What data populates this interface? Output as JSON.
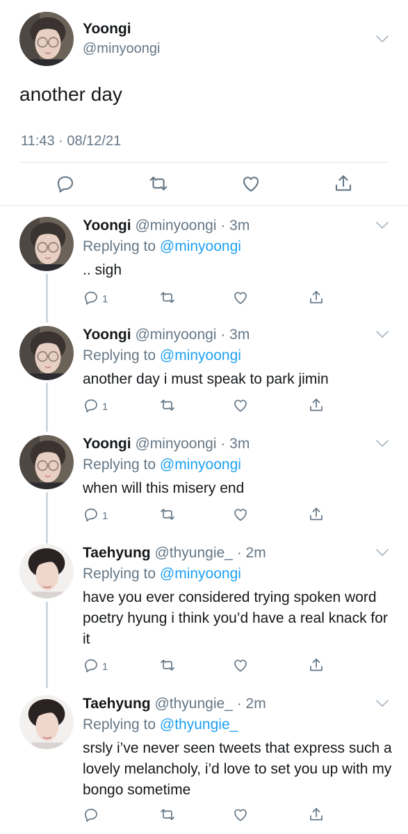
{
  "main": {
    "name": "Yoongi",
    "handle": "@minyoongi",
    "text": "another day",
    "timestamp": "11:43 · 08/12/21"
  },
  "replies": [
    {
      "name": "Yoongi",
      "handle": "@minyoongi",
      "time": "3m",
      "replying_label": "Replying to",
      "replying_to": "@minyoongi",
      "text": ".. sigh",
      "reply_count": "1"
    },
    {
      "name": "Yoongi",
      "handle": "@minyoongi",
      "time": "3m",
      "replying_label": "Replying to",
      "replying_to": "@minyoongi",
      "text": "another day i must speak to park jimin",
      "reply_count": "1"
    },
    {
      "name": "Yoongi",
      "handle": "@minyoongi",
      "time": "3m",
      "replying_label": "Replying to",
      "replying_to": "@minyoongi",
      "text": "when will this misery end",
      "reply_count": "1"
    },
    {
      "name": "Taehyung",
      "handle": "@thyungie_",
      "time": "2m",
      "replying_label": "Replying to",
      "replying_to": "@minyoongi",
      "text": "have you ever considered trying spoken word poetry hyung i think you’d have a real knack for it",
      "reply_count": "1"
    },
    {
      "name": "Taehyung",
      "handle": "@thyungie_",
      "time": "2m",
      "replying_label": "Replying to",
      "replying_to": "@thyungie_",
      "text": "srsly i’ve never seen tweets that express such a lovely melancholy, i’d love to set you up with my bongo sometime",
      "reply_count": ""
    }
  ],
  "icons": [
    "chevron-down-icon",
    "reply-icon",
    "retweet-icon",
    "like-icon",
    "share-icon"
  ],
  "colors": {
    "link": "#1da1f2",
    "secondary": "#657786",
    "divider": "#e1e8ed"
  }
}
